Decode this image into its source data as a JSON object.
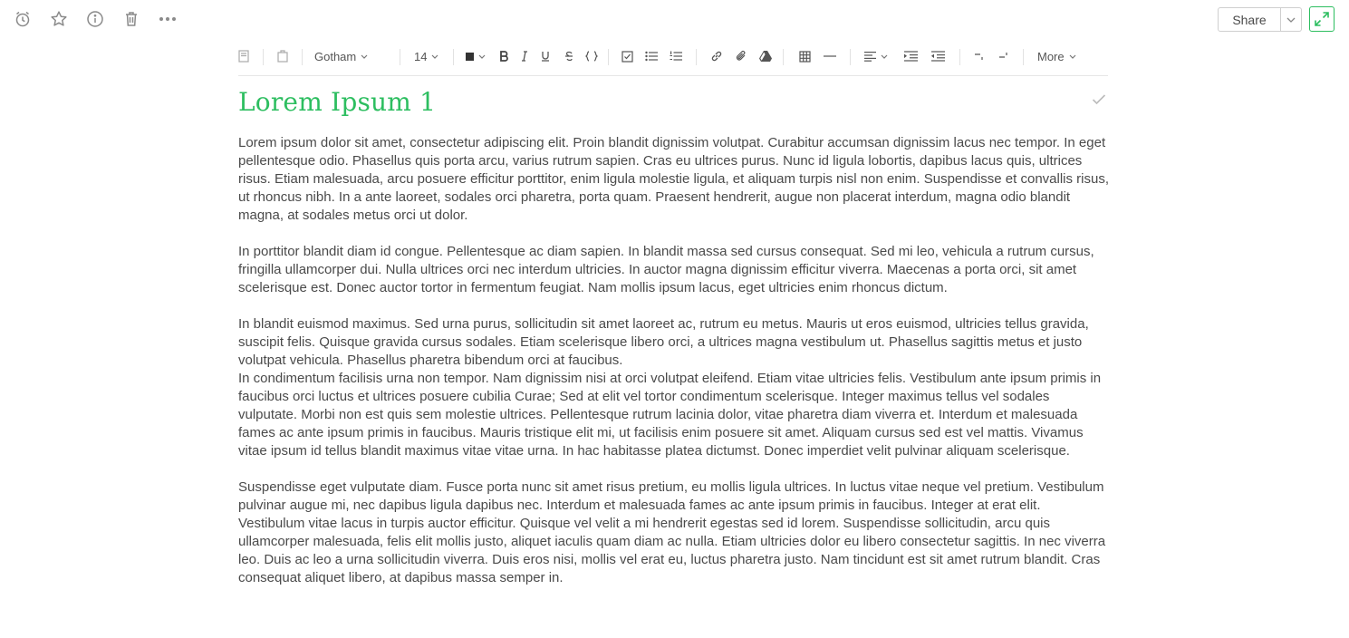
{
  "topbar": {
    "icons": [
      "reminder-icon",
      "star-icon",
      "info-icon",
      "trash-icon",
      "more-icon"
    ],
    "share_label": "Share"
  },
  "toolbar": {
    "font_family": "Gotham",
    "font_size": "14",
    "more_label": "More"
  },
  "note": {
    "title": "Lorem Ipsum 1",
    "paragraphs": [
      "Lorem ipsum dolor sit amet, consectetur adipiscing elit. Proin blandit dignissim volutpat. Curabitur accumsan dignissim lacus nec tempor. In eget pellentesque odio. Phasellus quis porta arcu, varius rutrum sapien. Cras eu ultrices purus. Nunc id ligula lobortis, dapibus lacus quis, ultrices risus. Etiam malesuada, arcu posuere efficitur porttitor, enim ligula molestie ligula, et aliquam turpis nisl non enim. Suspendisse et convallis risus, ut rhoncus nibh. In a ante laoreet, sodales orci pharetra, porta quam. Praesent hendrerit, augue non placerat interdum, magna odio blandit magna, at sodales metus orci ut dolor.",
      "In porttitor blandit diam id congue. Pellentesque ac diam sapien. In blandit massa sed cursus consequat. Sed mi leo, vehicula a rutrum cursus, fringilla ullamcorper dui. Nulla ultrices orci nec interdum ultricies. In auctor magna dignissim efficitur viverra. Maecenas a porta orci, sit amet scelerisque est. Donec auctor tortor in fermentum feugiat. Nam mollis ipsum lacus, eget ultricies enim rhoncus dictum.",
      "In blandit euismod maximus. Sed urna purus, sollicitudin sit amet laoreet ac, rutrum eu metus. Mauris ut eros euismod, ultricies tellus gravida, suscipit felis. Quisque gravida cursus sodales. Etiam scelerisque libero orci, a ultrices magna vestibulum ut. Phasellus sagittis metus et justo volutpat vehicula. Phasellus pharetra bibendum orci at faucibus.",
      "In condimentum facilisis urna non tempor. Nam dignissim nisi at orci volutpat eleifend. Etiam vitae ultricies felis. Vestibulum ante ipsum primis in faucibus orci luctus et ultrices posuere cubilia Curae; Sed at elit vel tortor condimentum scelerisque. Integer maximus tellus vel sodales vulputate. Morbi non est quis sem molestie ultrices. Pellentesque rutrum lacinia dolor, vitae pharetra diam viverra et. Interdum et malesuada fames ac ante ipsum primis in faucibus. Mauris tristique elit mi, ut facilisis enim posuere sit amet. Aliquam cursus sed est vel mattis. Vivamus vitae ipsum id tellus blandit maximus vitae vitae urna. In hac habitasse platea dictumst. Donec imperdiet velit pulvinar aliquam scelerisque.",
      "Suspendisse eget vulputate diam. Fusce porta nunc sit amet risus pretium, eu mollis ligula ultrices. In luctus vitae neque vel pretium. Vestibulum pulvinar augue mi, nec dapibus ligula dapibus nec. Interdum et malesuada fames ac ante ipsum primis in faucibus. Integer at erat elit. Vestibulum vitae lacus in turpis auctor efficitur. Quisque vel velit a mi hendrerit egestas sed id lorem. Suspendisse sollicitudin, arcu quis ullamcorper malesuada, felis elit mollis justo, aliquet iaculis quam diam ac nulla. Etiam ultricies dolor eu libero consectetur sagittis. In nec viverra leo. Duis ac leo a urna sollicitudin viverra. Duis eros nisi, mollis vel erat eu, luctus pharetra justo. Nam tincidunt est sit amet rutrum blandit. Cras consequat aliquet libero, at dapibus massa semper in."
    ]
  },
  "colors": {
    "accent": "#2dbe60",
    "text": "#4a4a4a",
    "spellcheck": "#e05050"
  }
}
